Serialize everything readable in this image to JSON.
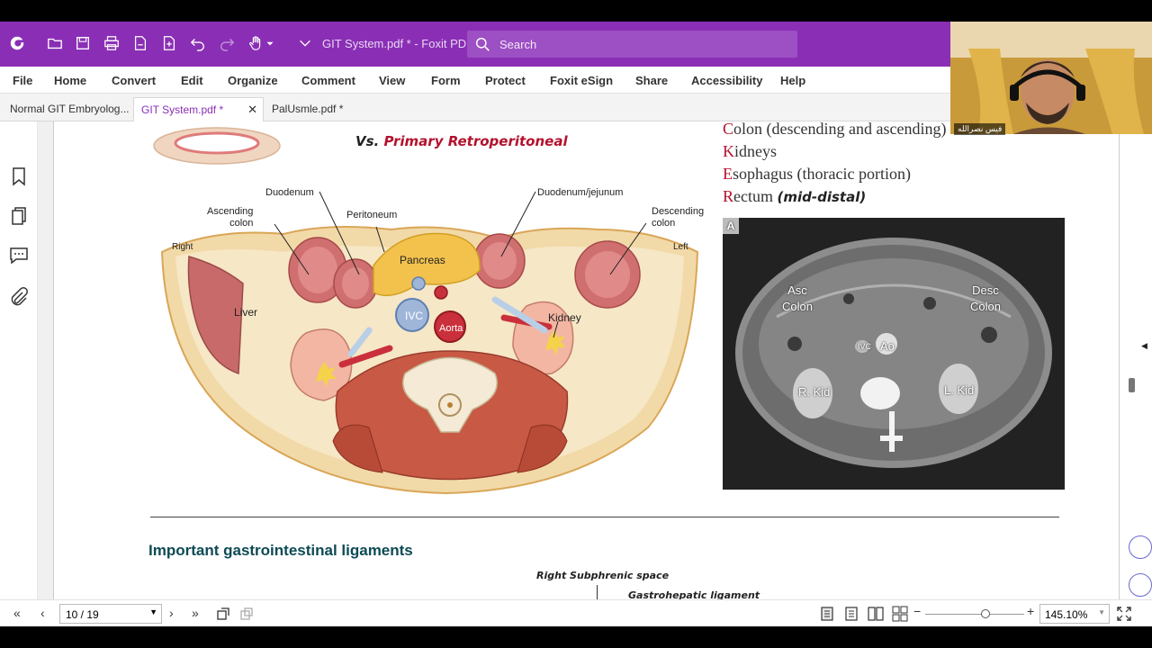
{
  "titlebar": {
    "doc_title": "GIT System.pdf * - Foxit PD...",
    "search_placeholder": "Search",
    "bg_color": "#8a2fb5"
  },
  "menu": [
    "File",
    "Home",
    "Convert",
    "Edit",
    "Organize",
    "Comment",
    "View",
    "Form",
    "Protect",
    "Foxit eSign",
    "Share",
    "Accessibility",
    "Help"
  ],
  "tabs": [
    {
      "label": "Normal GIT Embryolog...",
      "active": false
    },
    {
      "label": "GIT System.pdf *",
      "active": true
    },
    {
      "label": "PalUsmle.pdf *",
      "active": false
    }
  ],
  "sidebar_icons": [
    "bookmark-icon",
    "pages-icon",
    "comments-icon",
    "attachment-icon"
  ],
  "page": {
    "subheading_prefix": "Vs.",
    "subheading_em": "Primary Retroperitoneal",
    "list": [
      {
        "cap": "C",
        "rest": "olon (descending and ascending)",
        "extra": ""
      },
      {
        "cap": "K",
        "rest": "idneys",
        "extra": ""
      },
      {
        "cap": "E",
        "rest": "sophagus (thoracic portion)",
        "extra": ""
      },
      {
        "cap": "R",
        "rest": "ectum ",
        "extra": "(mid-distal)"
      }
    ],
    "diagram_labels": {
      "duodenum": "Duodenum",
      "duodenum_jejunum": "Duodenum/jejunum",
      "ascending_colon": "Ascending\ncolon",
      "peritoneum": "Peritoneum",
      "descending_colon": "Descending\ncolon",
      "right": "Right",
      "left": "Left",
      "pancreas": "Pancreas",
      "liver": "Liver",
      "ivc": "IVC",
      "aorta": "Aorta",
      "kidney": "Kidney"
    },
    "ct": {
      "panel_letter": "A",
      "asc_colon": "Asc\nColon",
      "desc_colon": "Desc\nColon",
      "ivc": "IVC",
      "ao": "Ao",
      "r_kid": "R. Kid",
      "l_kid": "L. Kid"
    },
    "section_title": "Important gastrointestinal ligaments",
    "sub_label_1": "Right Subphrenic space",
    "sub_label_2": "Gastrohepatic ligament"
  },
  "statusbar": {
    "page_indicator": "10 / 19",
    "zoom": "145.10%",
    "zoom_fraction": 0.62
  },
  "webcam": {
    "name": "فيس نصرالله"
  }
}
